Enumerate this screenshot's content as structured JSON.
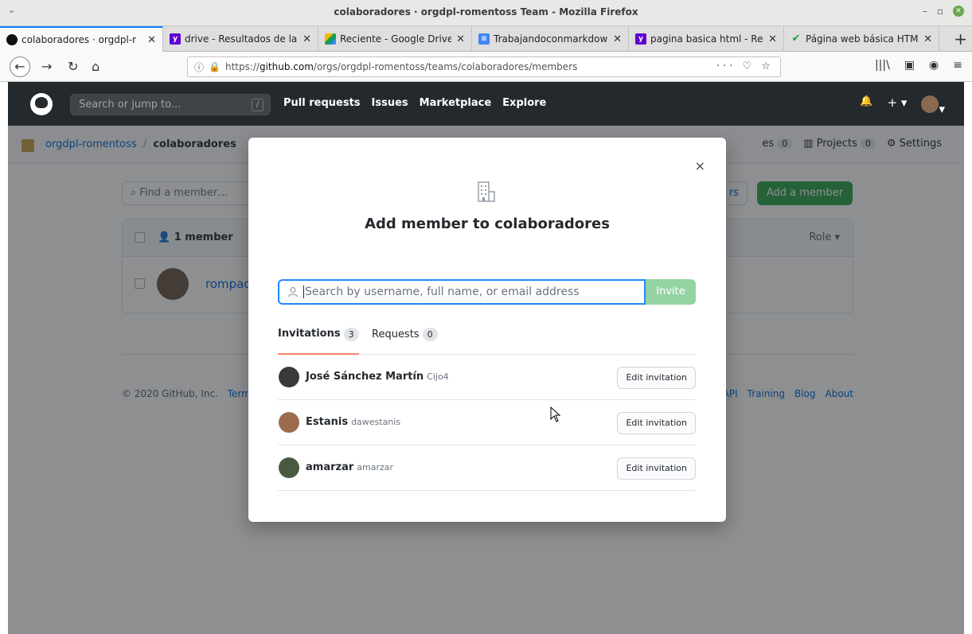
{
  "window": {
    "menu": "⌄",
    "title": "colaboradores · orgdpl-romentoss Team - Mozilla Firefox",
    "minimize": "–",
    "restore": "▫",
    "close": "✕"
  },
  "tabs": [
    {
      "label": "colaboradores · orgdpl-r",
      "favicon": "github-icon",
      "close": "✕"
    },
    {
      "label": "drive - Resultados de la",
      "favicon": "yahoo-icon",
      "close": "✕"
    },
    {
      "label": "Reciente - Google Drive",
      "favicon": "google-drive-icon",
      "close": "✕"
    },
    {
      "label": "Trabajandoconmarkdow",
      "favicon": "google-docs-icon",
      "close": "✕"
    },
    {
      "label": "pagina basica html - Res",
      "favicon": "yahoo-icon",
      "close": "✕"
    },
    {
      "label": "Página web básica HTML",
      "favicon": "checkmark-icon",
      "close": "✕"
    }
  ],
  "new_tab": "+",
  "navbar": {
    "back": "←",
    "forward": "→",
    "reload": "↻",
    "home": "⌂",
    "url_prefix": "https://",
    "url_host": "github.com",
    "url_path": "/orgs/orgdpl-romentoss/teams/colaboradores/members",
    "url_actions": "··· ♡ ☆",
    "right_icons": [
      "library-icon",
      "sidebar-icon",
      "extension-icon",
      "menu-icon"
    ],
    "right_glyphs": [
      "|||\\",
      "▣",
      "◉",
      "≡"
    ]
  },
  "github": {
    "search_placeholder": "Search or jump to...",
    "search_shortcut": "/",
    "nav": [
      "Pull requests",
      "Issues",
      "Marketplace",
      "Explore"
    ],
    "bell": "🔔",
    "plus": "+ ▾",
    "avatar_caret": "▾"
  },
  "org": {
    "name": "orgdpl-romentoss",
    "separator": "/",
    "team": "colaboradores",
    "tabs": [
      {
        "label": "es",
        "count": "0"
      },
      {
        "label": "Projects",
        "count": "0"
      },
      {
        "label": "Settings"
      }
    ]
  },
  "members": {
    "find_placeholder": "Find a member…",
    "ghost_button": "rs",
    "add_button": "Add a member",
    "count_label": "1 member",
    "role_label": "Role ▾",
    "rows": [
      {
        "login": "rompadp"
      }
    ]
  },
  "footer": {
    "copyright": "© 2020 GitHub, Inc.",
    "terms": "Terms",
    "right_links": [
      "API",
      "Training",
      "Blog",
      "About"
    ]
  },
  "modal": {
    "close": "×",
    "title": "Add member to colaboradores",
    "search_placeholder": "Search by username, full name, or email address",
    "invite_button": "Invite",
    "tabs": [
      {
        "label": "Invitations",
        "count": "3"
      },
      {
        "label": "Requests",
        "count": "0"
      }
    ],
    "invitations": [
      {
        "name": "José Sánchez Martín",
        "login": "Cijo4",
        "button": "Edit invitation",
        "avatar_color": "#3a3a3a"
      },
      {
        "name": "Estanis",
        "login": "dawestanis",
        "button": "Edit invitation",
        "avatar_color": "#9b6b4e"
      },
      {
        "name": "amarzar",
        "login": "amarzar",
        "button": "Edit invitation",
        "avatar_color": "#4a5a3f"
      }
    ]
  },
  "colors": {
    "accent": "#0366d6",
    "green": "#2ea44f",
    "invite_disabled": "#94d3a2",
    "header": "#24292e"
  }
}
